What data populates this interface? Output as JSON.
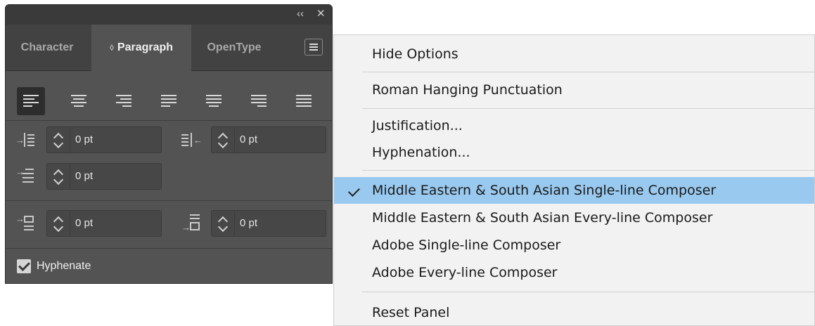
{
  "panel": {
    "collapse_glyph": "‹‹",
    "close_glyph": "✕",
    "tabs": [
      {
        "label": "Character"
      },
      {
        "label": "Paragraph",
        "active_prefix": "◊"
      },
      {
        "label": "OpenType"
      }
    ],
    "alignment_buttons": [
      "align-left-icon",
      "align-center-icon",
      "align-right-icon",
      "justify-last-left-icon",
      "justify-last-center-icon",
      "justify-last-right-icon",
      "justify-all-icon"
    ],
    "fields": {
      "left_indent": "0 pt",
      "right_indent": "0 pt",
      "first_line_indent": "0 pt",
      "space_before": "0 pt",
      "space_after": "0 pt"
    },
    "hyphenate_label": "Hyphenate",
    "hyphenate_checked": true
  },
  "menu": {
    "items": [
      {
        "label": "Hide Options"
      },
      {
        "label": "Roman Hanging Punctuation"
      },
      {
        "label": "Justification..."
      },
      {
        "label": "Hyphenation..."
      },
      {
        "label": "Middle Eastern & South Asian Single-line Composer",
        "checked": true
      },
      {
        "label": "Middle Eastern & South Asian Every-line Composer"
      },
      {
        "label": "Adobe Single-line Composer"
      },
      {
        "label": "Adobe Every-line Composer"
      },
      {
        "label": "Reset Panel"
      }
    ]
  },
  "colors": {
    "panel_bg": "#535353",
    "menu_bg": "#f2f2f2",
    "menu_highlight": "#99c9ef"
  }
}
